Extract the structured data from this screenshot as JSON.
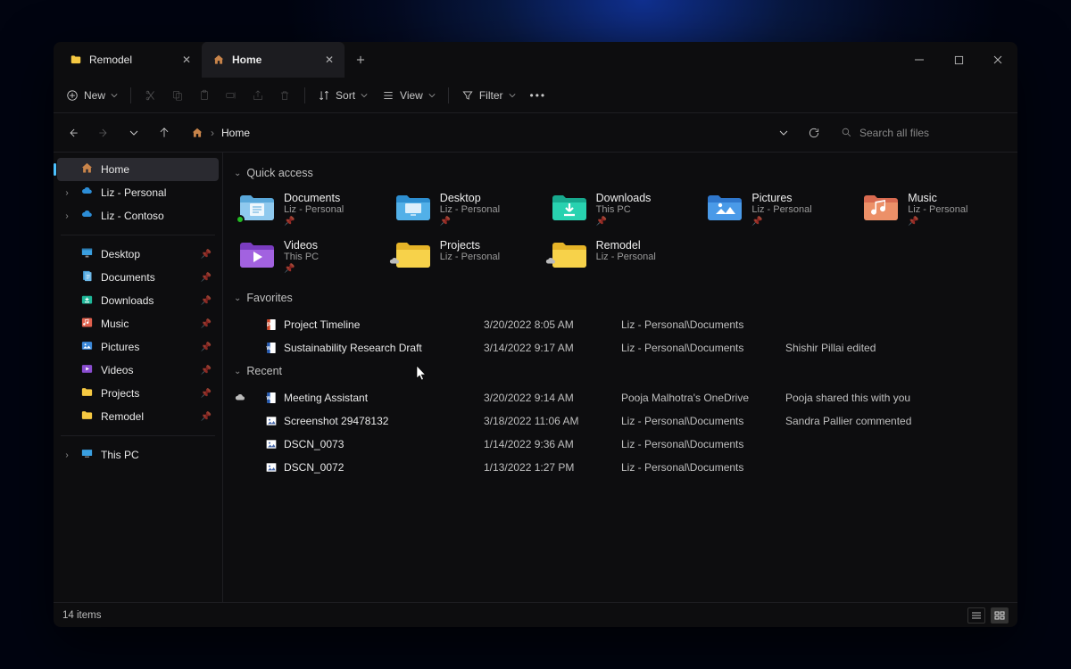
{
  "tabs": [
    {
      "label": "Remodel",
      "icon": "folder"
    },
    {
      "label": "Home",
      "icon": "home"
    }
  ],
  "active_tab": 1,
  "toolbar": {
    "new": "New",
    "sort": "Sort",
    "view": "View",
    "filter": "Filter"
  },
  "breadcrumb": {
    "root_icon": "home",
    "segments": [
      "Home"
    ]
  },
  "search": {
    "placeholder": "Search all files"
  },
  "sidebar": {
    "top": [
      {
        "icon": "home",
        "label": "Home",
        "active": true
      },
      {
        "icon": "onedrive",
        "label": "Liz - Personal",
        "expandable": true
      },
      {
        "icon": "onedrive",
        "label": "Liz - Contoso",
        "expandable": true
      }
    ],
    "pinned": [
      {
        "icon": "desktop",
        "label": "Desktop"
      },
      {
        "icon": "documents",
        "label": "Documents"
      },
      {
        "icon": "downloads",
        "label": "Downloads"
      },
      {
        "icon": "music",
        "label": "Music"
      },
      {
        "icon": "pictures",
        "label": "Pictures"
      },
      {
        "icon": "videos",
        "label": "Videos"
      },
      {
        "icon": "folder",
        "label": "Projects"
      },
      {
        "icon": "folder",
        "label": "Remodel"
      }
    ],
    "bottom": [
      {
        "icon": "thispc",
        "label": "This PC",
        "expandable": true
      }
    ]
  },
  "sections": {
    "quick_access": {
      "title": "Quick access",
      "items": [
        {
          "icon": "documents",
          "title": "Documents",
          "subtitle": "Liz - Personal",
          "pinned": true,
          "sync": true
        },
        {
          "icon": "desktop",
          "title": "Desktop",
          "subtitle": "Liz - Personal",
          "pinned": true
        },
        {
          "icon": "downloads",
          "title": "Downloads",
          "subtitle": "This PC",
          "pinned": true
        },
        {
          "icon": "pictures",
          "title": "Pictures",
          "subtitle": "Liz - Personal",
          "pinned": true
        },
        {
          "icon": "music",
          "title": "Music",
          "subtitle": "Liz - Personal",
          "pinned": true
        },
        {
          "icon": "videos",
          "title": "Videos",
          "subtitle": "This PC",
          "pinned": true
        },
        {
          "icon": "folder",
          "title": "Projects",
          "subtitle": "Liz - Personal",
          "cloud": true
        },
        {
          "icon": "folder",
          "title": "Remodel",
          "subtitle": "Liz - Personal",
          "cloud": true
        }
      ]
    },
    "favorites": {
      "title": "Favorites",
      "items": [
        {
          "icon": "ppt",
          "name": "Project Timeline",
          "date": "3/20/2022 8:05 AM",
          "location": "Liz - Personal\\Documents",
          "info": ""
        },
        {
          "icon": "word",
          "name": "Sustainability Research Draft",
          "date": "3/14/2022 9:17 AM",
          "location": "Liz - Personal\\Documents",
          "info": "Shishir Pillai edited"
        }
      ]
    },
    "recent": {
      "title": "Recent",
      "items": [
        {
          "icon": "word",
          "name": "Meeting Assistant",
          "date": "3/20/2022 9:14 AM",
          "location": "Pooja Malhotra's OneDrive",
          "info": "Pooja shared this with you",
          "cloud": true
        },
        {
          "icon": "image",
          "name": "Screenshot 29478132",
          "date": "3/18/2022 11:06 AM",
          "location": "Liz - Personal\\Documents",
          "info": "Sandra Pallier commented"
        },
        {
          "icon": "image",
          "name": "DSCN_0073",
          "date": "1/14/2022 9:36 AM",
          "location": "Liz - Personal\\Documents",
          "info": ""
        },
        {
          "icon": "image",
          "name": "DSCN_0072",
          "date": "1/13/2022 1:27 PM",
          "location": "Liz - Personal\\Documents",
          "info": ""
        }
      ]
    }
  },
  "status": {
    "count": "14 items"
  }
}
